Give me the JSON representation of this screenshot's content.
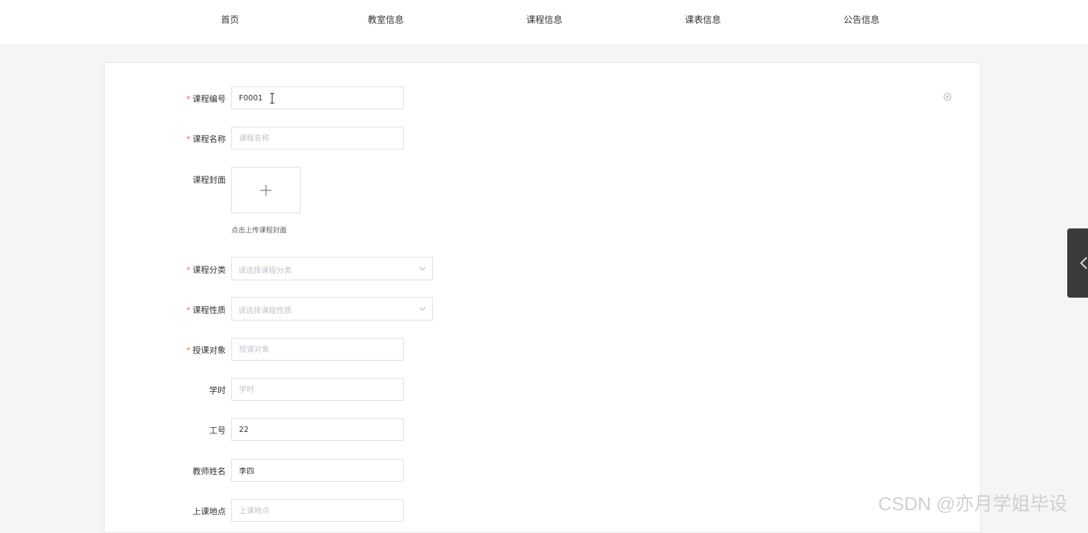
{
  "nav": {
    "items": [
      {
        "label": "首页"
      },
      {
        "label": "教室信息"
      },
      {
        "label": "课程信息"
      },
      {
        "label": "课表信息"
      },
      {
        "label": "公告信息"
      }
    ]
  },
  "form": {
    "course_code": {
      "label": "课程编号",
      "required": "*",
      "value": "F0001",
      "placeholder": ""
    },
    "course_name": {
      "label": "课程名称",
      "required": "*",
      "value": "",
      "placeholder": "课程名称"
    },
    "course_cover": {
      "label": "课程封面",
      "hint": "点击上传课程封面"
    },
    "course_category": {
      "label": "课程分类",
      "required": "*",
      "placeholder": "请选择课程分类"
    },
    "course_nature": {
      "label": "课程性质",
      "required": "*",
      "placeholder": "请选择课程性质"
    },
    "audience": {
      "label": "授课对象",
      "required": "*",
      "value": "",
      "placeholder": "授课对象"
    },
    "hours": {
      "label": "学时",
      "value": "",
      "placeholder": "学时"
    },
    "staff_id": {
      "label": "工号",
      "value": "22",
      "placeholder": ""
    },
    "teacher_name": {
      "label": "教师姓名",
      "value": "李四",
      "placeholder": ""
    },
    "location": {
      "label": "上课地点",
      "value": "",
      "placeholder": "上课地点"
    }
  },
  "watermark": "CSDN @亦月学姐毕设",
  "colors": {
    "required": "#f56c6c",
    "border": "#dcdfe6",
    "placeholder": "#c0c4cc",
    "background": "#f5f5f5",
    "side_tab": "#3b3b3b"
  },
  "icons": {
    "close": "close-circle-icon",
    "upload": "plus-icon",
    "select": "chevron-down-icon",
    "side_tab": "chevron-left-icon",
    "cursor": "text-cursor-icon"
  }
}
